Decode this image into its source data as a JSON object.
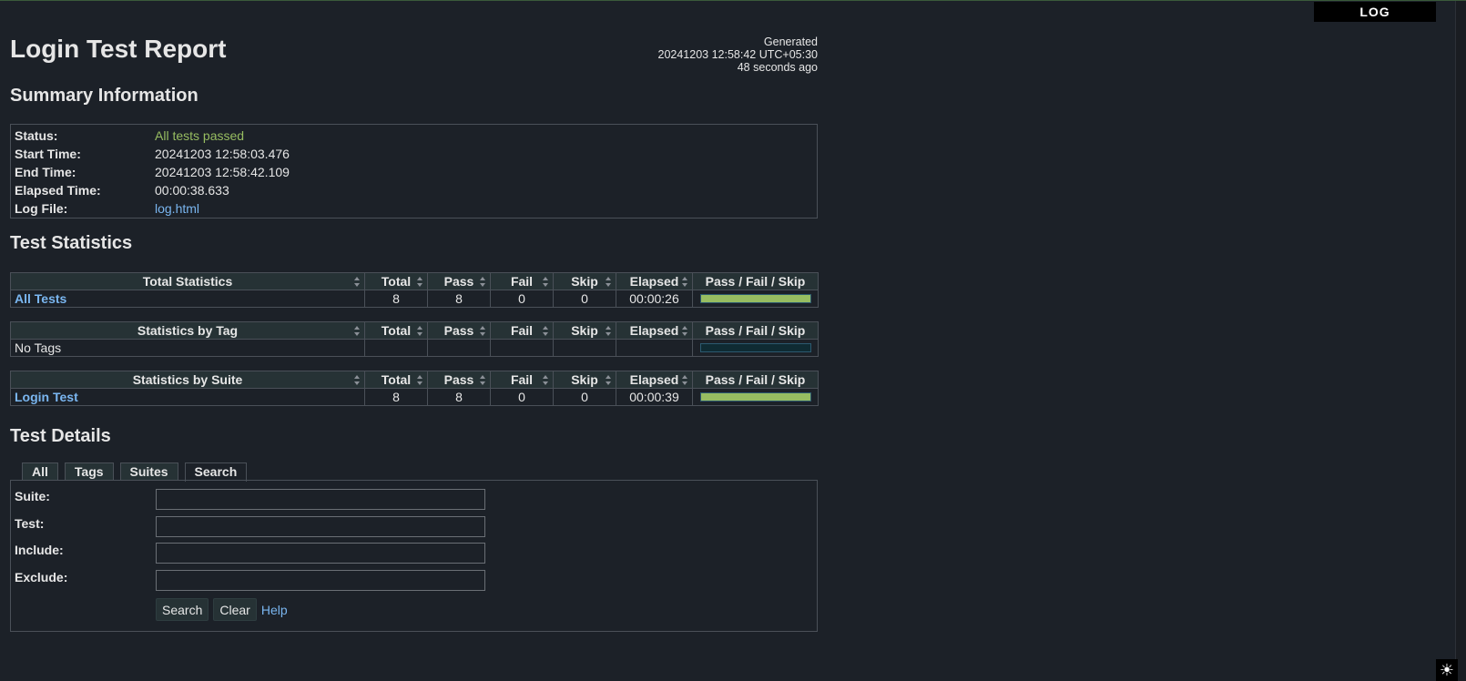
{
  "header": {
    "title": "Login Test Report",
    "log_link": "LOG",
    "generated_label": "Generated",
    "generated_time": "20241203 12:58:42 UTC+05:30",
    "generated_ago": "48 seconds ago"
  },
  "summary": {
    "heading": "Summary Information",
    "rows": [
      {
        "label": "Status:",
        "value": "All tests passed"
      },
      {
        "label": "Start Time:",
        "value": "20241203 12:58:03.476"
      },
      {
        "label": "End Time:",
        "value": "20241203 12:58:42.109"
      },
      {
        "label": "Elapsed Time:",
        "value": "00:00:38.633"
      },
      {
        "label": "Log File:",
        "value": "log.html"
      }
    ]
  },
  "statistics": {
    "heading": "Test Statistics",
    "columns": [
      "Total",
      "Pass",
      "Fail",
      "Skip",
      "Elapsed",
      "Pass / Fail / Skip"
    ],
    "tables": [
      {
        "title": "Total Statistics",
        "rows": [
          {
            "name": "All Tests",
            "total": "8",
            "pass": "8",
            "fail": "0",
            "skip": "0",
            "elapsed": "00:00:26",
            "pass_fraction": 1.0
          }
        ]
      },
      {
        "title": "Statistics by Tag",
        "rows": [
          {
            "name": "No Tags",
            "total": "",
            "pass": "",
            "fail": "",
            "skip": "",
            "elapsed": "",
            "pass_fraction": 0
          }
        ]
      },
      {
        "title": "Statistics by Suite",
        "rows": [
          {
            "name": "Login Test",
            "total": "8",
            "pass": "8",
            "fail": "0",
            "skip": "0",
            "elapsed": "00:00:39",
            "pass_fraction": 1.0
          }
        ]
      }
    ]
  },
  "details": {
    "heading": "Test Details",
    "tabs": [
      "All",
      "Tags",
      "Suites",
      "Search"
    ],
    "active_tab": "Search",
    "fields": [
      {
        "label": "Suite:",
        "value": ""
      },
      {
        "label": "Test:",
        "value": ""
      },
      {
        "label": "Include:",
        "value": ""
      },
      {
        "label": "Exclude:",
        "value": ""
      }
    ],
    "search_button": "Search",
    "clear_button": "Clear",
    "help_link": "Help"
  },
  "colors": {
    "background": "#1c2128",
    "pass": "#97bd61",
    "link": "#7ab6f0",
    "header_bg": "#263235"
  },
  "icons": {
    "theme_toggle": "sun-icon",
    "sort": "sort-icon"
  }
}
